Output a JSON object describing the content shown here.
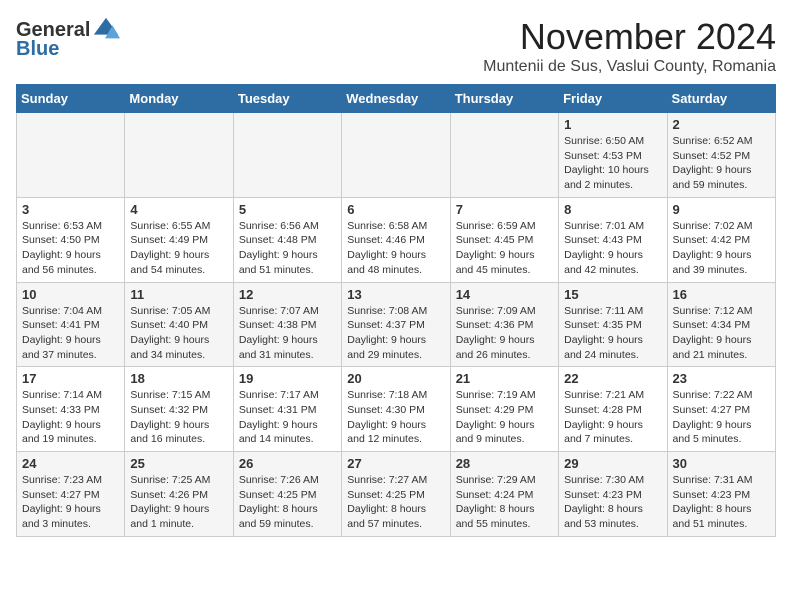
{
  "logo": {
    "general": "General",
    "blue": "Blue"
  },
  "title": "November 2024",
  "location": "Muntenii de Sus, Vaslui County, Romania",
  "days_of_week": [
    "Sunday",
    "Monday",
    "Tuesday",
    "Wednesday",
    "Thursday",
    "Friday",
    "Saturday"
  ],
  "weeks": [
    [
      {
        "day": "",
        "info": ""
      },
      {
        "day": "",
        "info": ""
      },
      {
        "day": "",
        "info": ""
      },
      {
        "day": "",
        "info": ""
      },
      {
        "day": "",
        "info": ""
      },
      {
        "day": "1",
        "info": "Sunrise: 6:50 AM\nSunset: 4:53 PM\nDaylight: 10 hours\nand 2 minutes."
      },
      {
        "day": "2",
        "info": "Sunrise: 6:52 AM\nSunset: 4:52 PM\nDaylight: 9 hours\nand 59 minutes."
      }
    ],
    [
      {
        "day": "3",
        "info": "Sunrise: 6:53 AM\nSunset: 4:50 PM\nDaylight: 9 hours\nand 56 minutes."
      },
      {
        "day": "4",
        "info": "Sunrise: 6:55 AM\nSunset: 4:49 PM\nDaylight: 9 hours\nand 54 minutes."
      },
      {
        "day": "5",
        "info": "Sunrise: 6:56 AM\nSunset: 4:48 PM\nDaylight: 9 hours\nand 51 minutes."
      },
      {
        "day": "6",
        "info": "Sunrise: 6:58 AM\nSunset: 4:46 PM\nDaylight: 9 hours\nand 48 minutes."
      },
      {
        "day": "7",
        "info": "Sunrise: 6:59 AM\nSunset: 4:45 PM\nDaylight: 9 hours\nand 45 minutes."
      },
      {
        "day": "8",
        "info": "Sunrise: 7:01 AM\nSunset: 4:43 PM\nDaylight: 9 hours\nand 42 minutes."
      },
      {
        "day": "9",
        "info": "Sunrise: 7:02 AM\nSunset: 4:42 PM\nDaylight: 9 hours\nand 39 minutes."
      }
    ],
    [
      {
        "day": "10",
        "info": "Sunrise: 7:04 AM\nSunset: 4:41 PM\nDaylight: 9 hours\nand 37 minutes."
      },
      {
        "day": "11",
        "info": "Sunrise: 7:05 AM\nSunset: 4:40 PM\nDaylight: 9 hours\nand 34 minutes."
      },
      {
        "day": "12",
        "info": "Sunrise: 7:07 AM\nSunset: 4:38 PM\nDaylight: 9 hours\nand 31 minutes."
      },
      {
        "day": "13",
        "info": "Sunrise: 7:08 AM\nSunset: 4:37 PM\nDaylight: 9 hours\nand 29 minutes."
      },
      {
        "day": "14",
        "info": "Sunrise: 7:09 AM\nSunset: 4:36 PM\nDaylight: 9 hours\nand 26 minutes."
      },
      {
        "day": "15",
        "info": "Sunrise: 7:11 AM\nSunset: 4:35 PM\nDaylight: 9 hours\nand 24 minutes."
      },
      {
        "day": "16",
        "info": "Sunrise: 7:12 AM\nSunset: 4:34 PM\nDaylight: 9 hours\nand 21 minutes."
      }
    ],
    [
      {
        "day": "17",
        "info": "Sunrise: 7:14 AM\nSunset: 4:33 PM\nDaylight: 9 hours\nand 19 minutes."
      },
      {
        "day": "18",
        "info": "Sunrise: 7:15 AM\nSunset: 4:32 PM\nDaylight: 9 hours\nand 16 minutes."
      },
      {
        "day": "19",
        "info": "Sunrise: 7:17 AM\nSunset: 4:31 PM\nDaylight: 9 hours\nand 14 minutes."
      },
      {
        "day": "20",
        "info": "Sunrise: 7:18 AM\nSunset: 4:30 PM\nDaylight: 9 hours\nand 12 minutes."
      },
      {
        "day": "21",
        "info": "Sunrise: 7:19 AM\nSunset: 4:29 PM\nDaylight: 9 hours\nand 9 minutes."
      },
      {
        "day": "22",
        "info": "Sunrise: 7:21 AM\nSunset: 4:28 PM\nDaylight: 9 hours\nand 7 minutes."
      },
      {
        "day": "23",
        "info": "Sunrise: 7:22 AM\nSunset: 4:27 PM\nDaylight: 9 hours\nand 5 minutes."
      }
    ],
    [
      {
        "day": "24",
        "info": "Sunrise: 7:23 AM\nSunset: 4:27 PM\nDaylight: 9 hours\nand 3 minutes."
      },
      {
        "day": "25",
        "info": "Sunrise: 7:25 AM\nSunset: 4:26 PM\nDaylight: 9 hours\nand 1 minute."
      },
      {
        "day": "26",
        "info": "Sunrise: 7:26 AM\nSunset: 4:25 PM\nDaylight: 8 hours\nand 59 minutes."
      },
      {
        "day": "27",
        "info": "Sunrise: 7:27 AM\nSunset: 4:25 PM\nDaylight: 8 hours\nand 57 minutes."
      },
      {
        "day": "28",
        "info": "Sunrise: 7:29 AM\nSunset: 4:24 PM\nDaylight: 8 hours\nand 55 minutes."
      },
      {
        "day": "29",
        "info": "Sunrise: 7:30 AM\nSunset: 4:23 PM\nDaylight: 8 hours\nand 53 minutes."
      },
      {
        "day": "30",
        "info": "Sunrise: 7:31 AM\nSunset: 4:23 PM\nDaylight: 8 hours\nand 51 minutes."
      }
    ]
  ]
}
